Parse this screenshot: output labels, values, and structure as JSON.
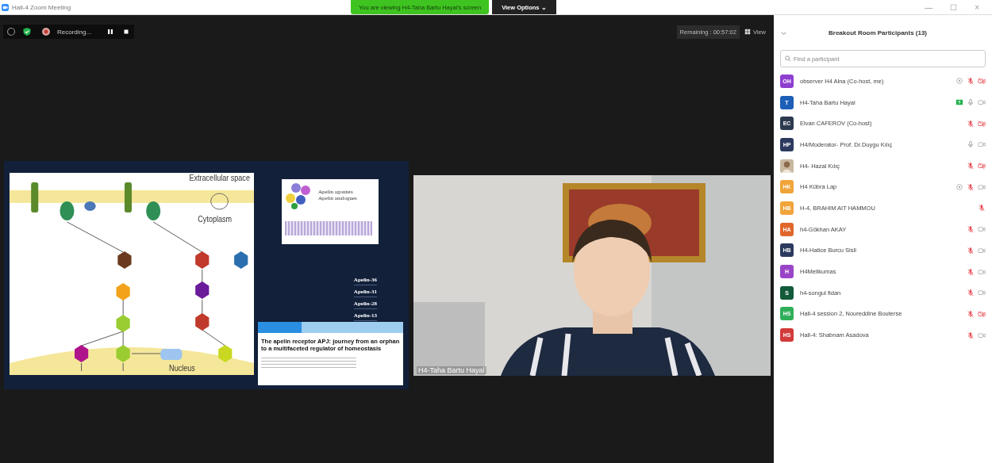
{
  "window": {
    "title": "Hall-4  Zoom Meeting",
    "controls": [
      "—",
      "☐",
      "×"
    ]
  },
  "share_banner": {
    "text": "You are viewing H4-Taha Bartu Hayal's screen",
    "options": "View Options ⌄"
  },
  "toolbar": {
    "recording": "Recording...",
    "remaining": "Remaining : 00:57:02",
    "view": "View"
  },
  "slide": {
    "labels": [
      "Extracellular space",
      "Cytoplasm",
      "Nucleus"
    ],
    "agonists": [
      "Apelin agonists",
      "Apelin analogues"
    ],
    "isoforms": [
      "Apelin-36",
      "Apelin-31",
      "Apelin-28",
      "Apelin-13"
    ],
    "paper_title": "The apelin receptor APJ: journey from an orphan to a multifaceted regulator of homeostasis"
  },
  "video": {
    "kind": "picture",
    "name": "H4-Taha Bartu Hayal"
  },
  "panel": {
    "title": "Breakout Room Participants (13)",
    "search": {
      "placeholder": "Find a participant"
    },
    "participants": [
      {
        "initials": "OH",
        "color": "#8e3fcf",
        "name": "observer H4 Alna (Co-host, me)",
        "status_badge": true,
        "sharing": false,
        "mic_muted": true,
        "video_off": true
      },
      {
        "initials": "T",
        "color": "#1d5fb8",
        "name": "H4-Taha Bartu Hayal",
        "status_badge": false,
        "sharing": true,
        "mic_muted": false,
        "video_off": false
      },
      {
        "initials": "EC",
        "color": "#2c3a4f",
        "name": "Elvan CAFEROV (Co-host)",
        "status_badge": false,
        "sharing": false,
        "mic_muted": true,
        "video_off": true
      },
      {
        "initials": "HP",
        "color": "#2c3a5f",
        "name": "H4/Moderator- Prof. Dr.Duygu Kılıç",
        "status_badge": false,
        "sharing": false,
        "mic_muted": false,
        "video_off": false
      },
      {
        "kind": "picture",
        "name": "H4- Hazal Kılıç",
        "status_badge": false,
        "sharing": false,
        "mic_muted": true,
        "video_off": true
      },
      {
        "initials": "HK",
        "color": "#f0a43a",
        "name": "H4 Kübra Lap",
        "status_badge": true,
        "sharing": false,
        "mic_muted": true,
        "video_off": false
      },
      {
        "initials": "HB",
        "color": "#f0a43a",
        "name": "H-4, BRAHIM AIT HAMMOU",
        "status_badge": false,
        "sharing": false,
        "mic_muted": true
      },
      {
        "initials": "HA",
        "color": "#e0672a",
        "name": "h4-Gökhan AKAY",
        "status_badge": false,
        "sharing": false,
        "mic_muted": true,
        "video_off": false
      },
      {
        "initials": "HB",
        "color": "#2c3a5f",
        "name": "H4-Hatice Burcu Sisli",
        "status_badge": false,
        "sharing": false,
        "mic_muted": true,
        "video_off": false
      },
      {
        "initials": "H",
        "color": "#9a45c8",
        "name": "H4Melikumas",
        "status_badge": false,
        "sharing": false,
        "mic_muted": true,
        "video_off": false
      },
      {
        "initials": "S",
        "color": "#135a3a",
        "name": "h4-songul fidan",
        "status_badge": false,
        "sharing": false,
        "mic_muted": true,
        "video_off": false
      },
      {
        "initials": "HS",
        "color": "#2fae5a",
        "name": "Hall-4 session 2,  Noureddine Bouterse",
        "status_badge": false,
        "sharing": false,
        "mic_muted": true,
        "video_off": true
      },
      {
        "initials": "HS",
        "color": "#d33a3a",
        "name": "Hall-4: Shabnam Asadova",
        "status_badge": false,
        "sharing": false,
        "mic_muted": true,
        "video_off": false
      }
    ]
  }
}
